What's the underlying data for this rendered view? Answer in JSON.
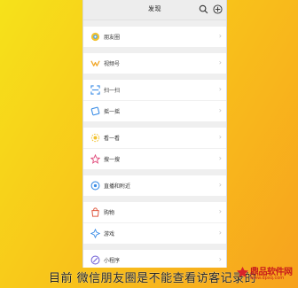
{
  "header": {
    "title": "发现"
  },
  "groups": [
    [
      {
        "label": "朋友圈",
        "icon": "moments-icon"
      }
    ],
    [
      {
        "label": "视频号",
        "icon": "channels-icon"
      }
    ],
    [
      {
        "label": "扫一扫",
        "icon": "scan-icon"
      },
      {
        "label": "摇一摇",
        "icon": "shake-icon"
      }
    ],
    [
      {
        "label": "看一看",
        "icon": "top-stories-icon"
      },
      {
        "label": "搜一搜",
        "icon": "search-star-icon"
      }
    ],
    [
      {
        "label": "直播和附近",
        "icon": "live-nearby-icon"
      }
    ],
    [
      {
        "label": "购物",
        "icon": "shopping-icon"
      },
      {
        "label": "游戏",
        "icon": "games-icon"
      }
    ],
    [
      {
        "label": "小程序",
        "icon": "mini-programs-icon"
      }
    ]
  ],
  "chevron": "›",
  "caption": "目前 微信朋友圈是不能查看访客记录的",
  "watermark": {
    "title": "鼎品软件网",
    "sub": "www.dpxq.com"
  }
}
